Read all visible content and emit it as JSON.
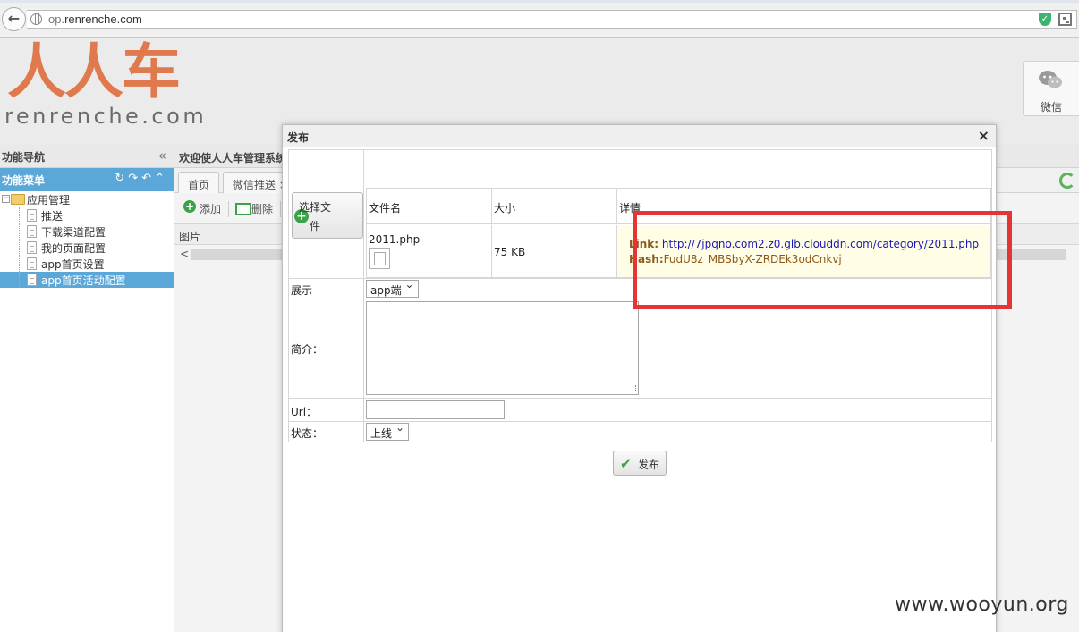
{
  "browser": {
    "url_host": "op.",
    "url_domain": "renrenche.com"
  },
  "logo": {
    "mark_text": "人人车",
    "word_text": "renrenche.com"
  },
  "wechat": {
    "label": "微信"
  },
  "nav": {
    "header_title": "功能导航",
    "menu_title": "功能菜单",
    "tree": {
      "root_label": "应用管理",
      "items": [
        {
          "label": "推送"
        },
        {
          "label": "下载渠道配置"
        },
        {
          "label": "我的页面配置"
        },
        {
          "label": "app首页设置"
        },
        {
          "label": "app首页活动配置"
        }
      ]
    }
  },
  "main": {
    "welcome": "欢迎使人人车管理系统",
    "tabs": [
      {
        "label": "首页"
      },
      {
        "label": "微信推送 ×"
      }
    ],
    "toolbar": {
      "add_label": "添加",
      "delete_label": "删除"
    },
    "grid_header": "图片"
  },
  "dialog": {
    "title": "发布",
    "close": "×",
    "choose_file_label": "选择文件",
    "file_table": {
      "headers": [
        "文件名",
        "大小",
        "详情"
      ],
      "row": {
        "filename": "2011.php",
        "size": "75 KB",
        "link_key": "Link:",
        "link_url": " http://7jpqno.com2.z0.glb.clouddn.com/category/2011.php",
        "hash_key": "Hash:",
        "hash_value": "FudU8z_MBSbyX-ZRDEk3odCnkvj_"
      }
    },
    "fields": {
      "display_label": "展示",
      "display_value": "app端",
      "intro_label": "简介：",
      "url_label": "Url：",
      "url_value": "",
      "status_label": "状态：",
      "status_value": "上线"
    },
    "publish_label": "发布"
  },
  "watermark": "www.wooyun.org",
  "colors": {
    "accent_blue": "#5aa7d8",
    "logo_orange": "#e07a4e",
    "highlight_red": "#e53434",
    "link_blue": "#1a1ab3"
  }
}
